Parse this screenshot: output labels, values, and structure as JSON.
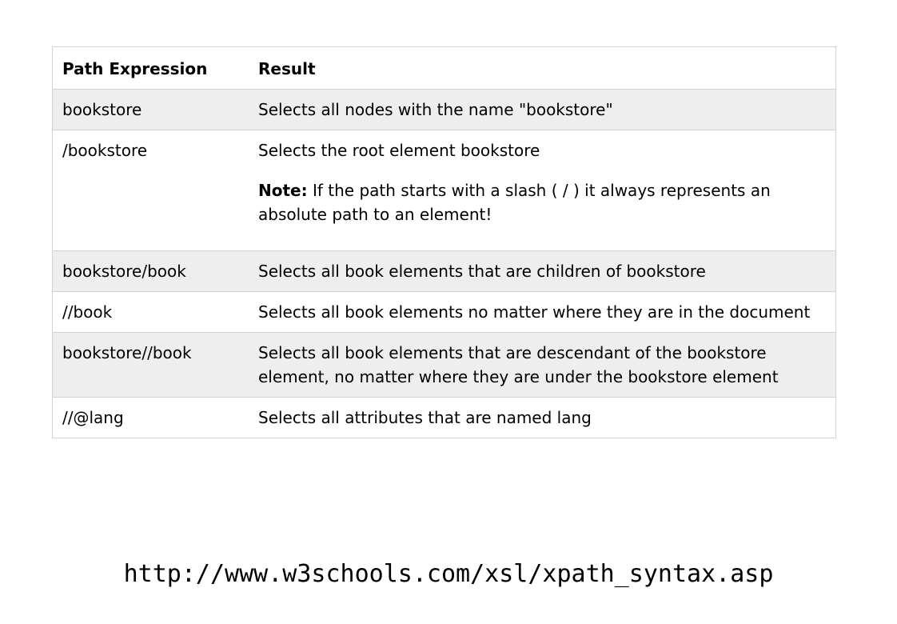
{
  "table": {
    "headers": [
      "Path Expression",
      "Result"
    ],
    "rows": [
      {
        "path": "bookstore",
        "result": "Selects all nodes with the name \"bookstore\""
      },
      {
        "path": "/bookstore",
        "result": "Selects the root element bookstore",
        "note_label": "Note:",
        "note_text": " If the path starts with a slash ( / ) it always represents an absolute path to an element!"
      },
      {
        "path": "bookstore/book",
        "result": "Selects all book elements that are children of bookstore"
      },
      {
        "path": "//book",
        "result": "Selects all book elements no matter where they are in the document"
      },
      {
        "path": "bookstore//book",
        "result": "Selects all book elements that are descendant of the bookstore element, no matter where they are under the bookstore element"
      },
      {
        "path": "//@lang",
        "result": "Selects all attributes that are named lang"
      }
    ]
  },
  "source_url": "http://www.w3schools.com/xsl/xpath_syntax.asp",
  "colors": {
    "shaded_row": "#eeeeee",
    "border": "#d4d4d4"
  }
}
